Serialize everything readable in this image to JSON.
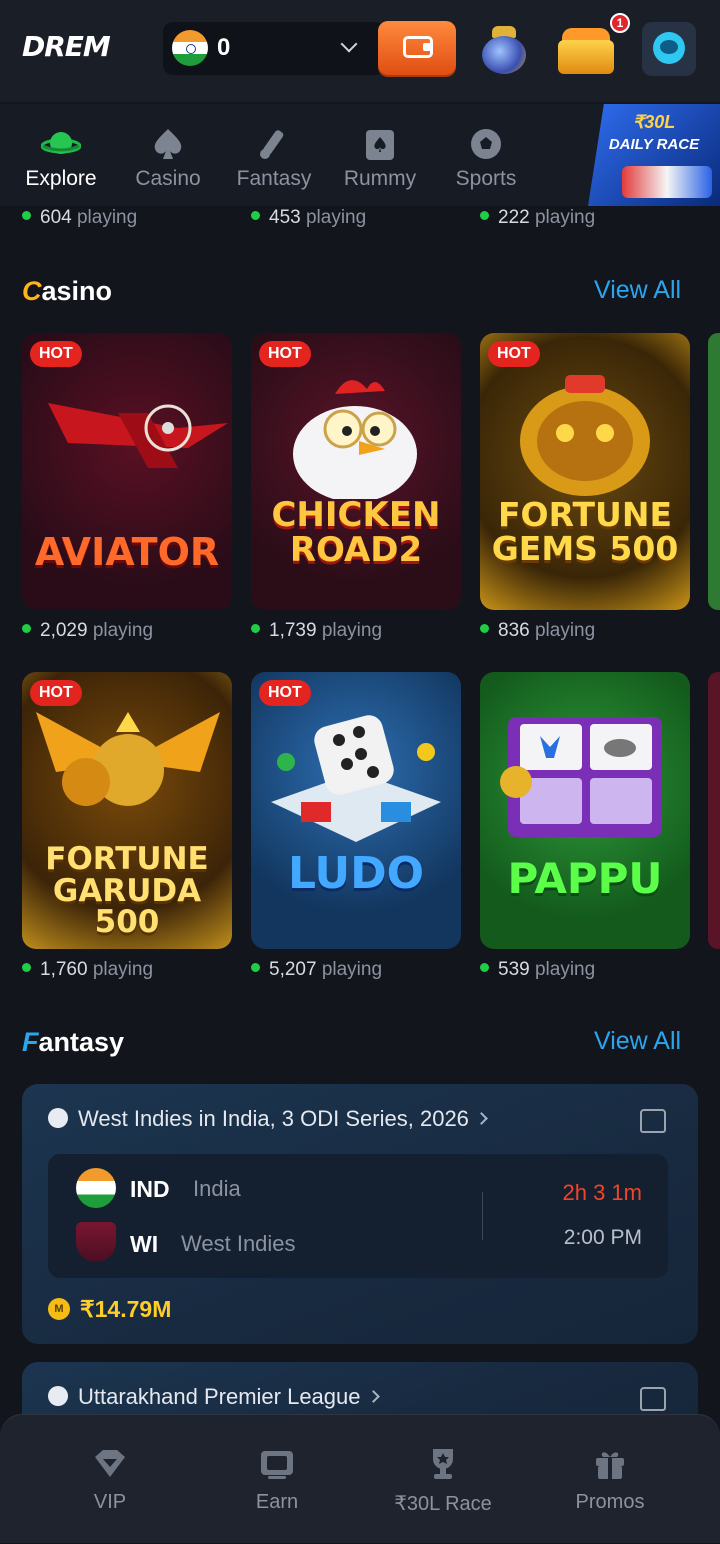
{
  "header": {
    "logo": "DREM",
    "balance": "0",
    "notification_count": "1"
  },
  "categories": [
    {
      "label": "Explore",
      "icon": "planet-icon",
      "active": true
    },
    {
      "label": "Casino",
      "icon": "spade-icon",
      "active": false
    },
    {
      "label": "Fantasy",
      "icon": "cricket-bat-icon",
      "active": false
    },
    {
      "label": "Rummy",
      "icon": "cards-icon",
      "active": false
    },
    {
      "label": "Sports",
      "icon": "football-icon",
      "active": false
    }
  ],
  "race_banner": {
    "line1": "₹30L",
    "line2": "DAILY RACE"
  },
  "top_playing": [
    {
      "count": "604",
      "suffix": "playing"
    },
    {
      "count": "453",
      "suffix": "playing"
    },
    {
      "count": "222",
      "suffix": "playing"
    }
  ],
  "casino": {
    "title_first": "C",
    "title_rest": "asino",
    "view_all": "View All",
    "games": [
      {
        "name_line1": "AVIATOR",
        "name_line2": "",
        "badge": "HOT",
        "count": "2,029",
        "suffix": "playing"
      },
      {
        "name_line1": "CHICKEN",
        "name_line2": "ROAD2",
        "badge": "HOT",
        "count": "1,739",
        "suffix": "playing"
      },
      {
        "name_line1": "FORTUNE",
        "name_line2": "GEMS 500",
        "badge": "HOT",
        "count": "836",
        "suffix": "playing"
      },
      {
        "name_line1": "FORTUNE",
        "name_line2": "GARUDA 500",
        "badge": "HOT",
        "count": "1,760",
        "suffix": "playing"
      },
      {
        "name_line1": "LUDO",
        "name_line2": "",
        "badge": "HOT",
        "count": "5,207",
        "suffix": "playing"
      },
      {
        "name_line1": "PAPPU",
        "name_line2": "",
        "badge": "",
        "count": "539",
        "suffix": "playing"
      }
    ]
  },
  "fantasy": {
    "title_first": "F",
    "title_rest": "antasy",
    "view_all": "View All",
    "matches": [
      {
        "series": "West Indies in India, 3 ODI Series, 2026",
        "team1_code": "IND",
        "team1_name": "India",
        "team2_code": "WI",
        "team2_name": "West Indies",
        "countdown": "2h 3 1m",
        "time": "2:00 PM",
        "coin": "M",
        "prize": "₹14.79M"
      },
      {
        "series": "Uttarakhand Premier League"
      }
    ]
  },
  "bottom_nav": [
    {
      "label": "VIP",
      "icon": "diamond-icon"
    },
    {
      "label": "Earn",
      "icon": "rupee-screen-icon"
    },
    {
      "label": "₹30L Race",
      "icon": "trophy-icon"
    },
    {
      "label": "Promos",
      "icon": "gift-icon"
    }
  ]
}
